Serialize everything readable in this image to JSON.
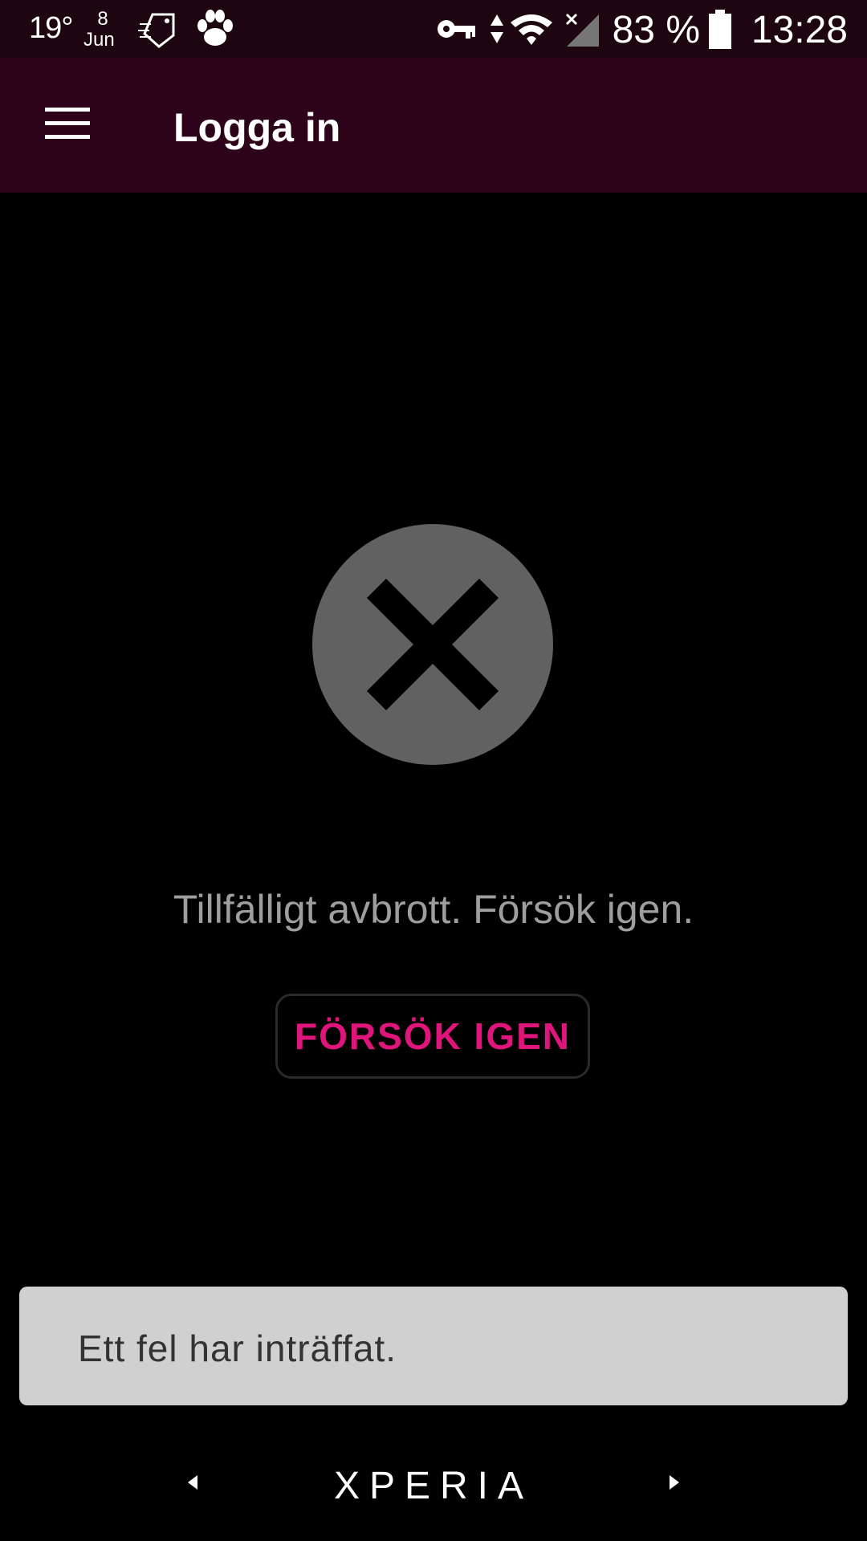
{
  "status_bar": {
    "temperature": "19°",
    "date_day": "8",
    "date_month": "Jun",
    "battery_percent": "83 %",
    "time": "13:28",
    "icons": [
      "weather-icon",
      "calendar-icon",
      "tag-icon",
      "paw-icon",
      "vpn-key-icon",
      "data-arrows-icon",
      "wifi-icon",
      "no-signal-icon",
      "battery-icon"
    ]
  },
  "app_bar": {
    "title": "Logga in",
    "menu_icon": "hamburger-menu-icon"
  },
  "error": {
    "icon": "error-x-circle-icon",
    "message": "Tillfälligt avbrott. Försök igen.",
    "retry_label": "FÖRSÖK IGEN",
    "accent_color": "#e0157c"
  },
  "snackbar": {
    "text": "Ett fel har inträffat."
  },
  "nav_bar": {
    "brand": "XPERIA",
    "back_icon": "back-arrow-icon",
    "forward_icon": "forward-arrow-icon"
  }
}
